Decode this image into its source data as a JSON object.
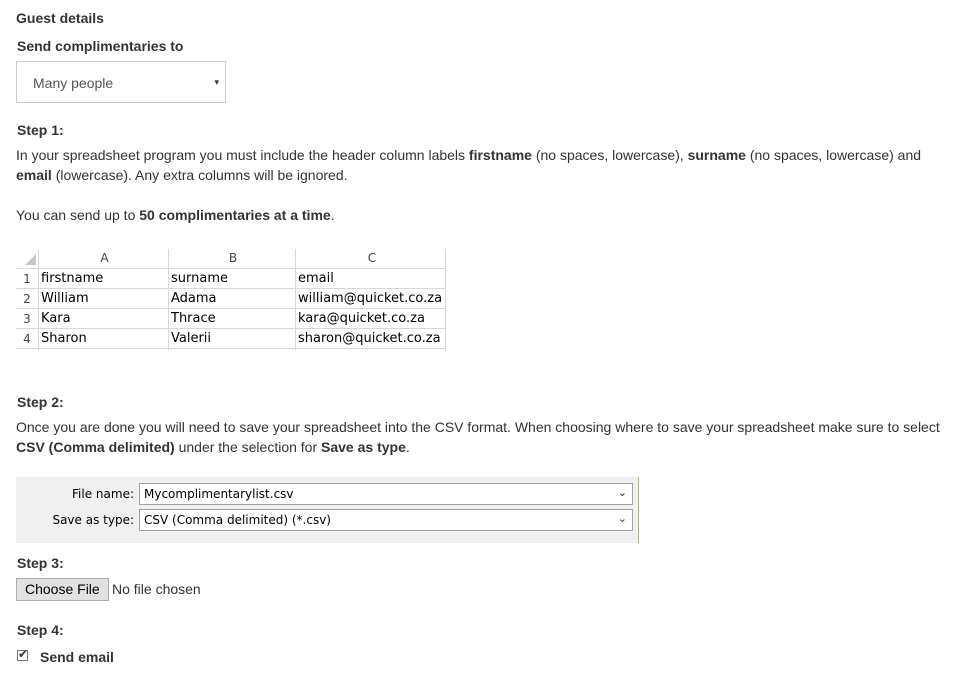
{
  "section_title": "Guest details",
  "send_to": {
    "label": "Send complimentaries to",
    "selected": "Many people",
    "arrow": "▾"
  },
  "step1": {
    "heading": "Step 1:",
    "line1_a": "In your spreadsheet program you must include the header column labels ",
    "line1_b": "firstname",
    "line1_c": " (no spaces, lowercase), ",
    "line1_d": "surname",
    "line1_e": " (no spaces, lowercase) and",
    "line2_a": "email",
    "line2_b": " (lowercase). Any extra columns will be ignored.",
    "limit_a": "You can send up to ",
    "limit_b": "50 complimentaries at a time",
    "limit_c": "."
  },
  "spreadsheet": {
    "columns": [
      "A",
      "B",
      "C"
    ],
    "rows": [
      {
        "num": "1",
        "cells": [
          "firstname",
          "surname",
          "email"
        ]
      },
      {
        "num": "2",
        "cells": [
          "William",
          "Adama",
          "william@quicket.co.za"
        ]
      },
      {
        "num": "3",
        "cells": [
          "Kara",
          "Thrace",
          "kara@quicket.co.za"
        ]
      },
      {
        "num": "4",
        "cells": [
          "Sharon",
          "Valerii",
          "sharon@quicket.co.za"
        ]
      }
    ]
  },
  "step2": {
    "heading": "Step 2:",
    "line1": "Once you are done you will need to save your spreadsheet into the CSV format. When choosing where to save your spreadsheet make sure to select",
    "line2_a": "CSV (Comma delimited)",
    "line2_b": " under the selection for ",
    "line2_c": "Save as type",
    "line2_d": "."
  },
  "save_dialog": {
    "file_name_label": "File name:",
    "file_name_value": "Mycomplimentarylist.csv",
    "save_type_label": "Save as type:",
    "save_type_value": "CSV (Comma delimited) (*.csv)",
    "chevron": "⌄"
  },
  "step3": {
    "heading": "Step 3:",
    "button": "Choose File",
    "status": "No file chosen"
  },
  "step4": {
    "heading": "Step 4:",
    "checkbox_label": "Send email",
    "checked": true,
    "tick": "✔"
  }
}
